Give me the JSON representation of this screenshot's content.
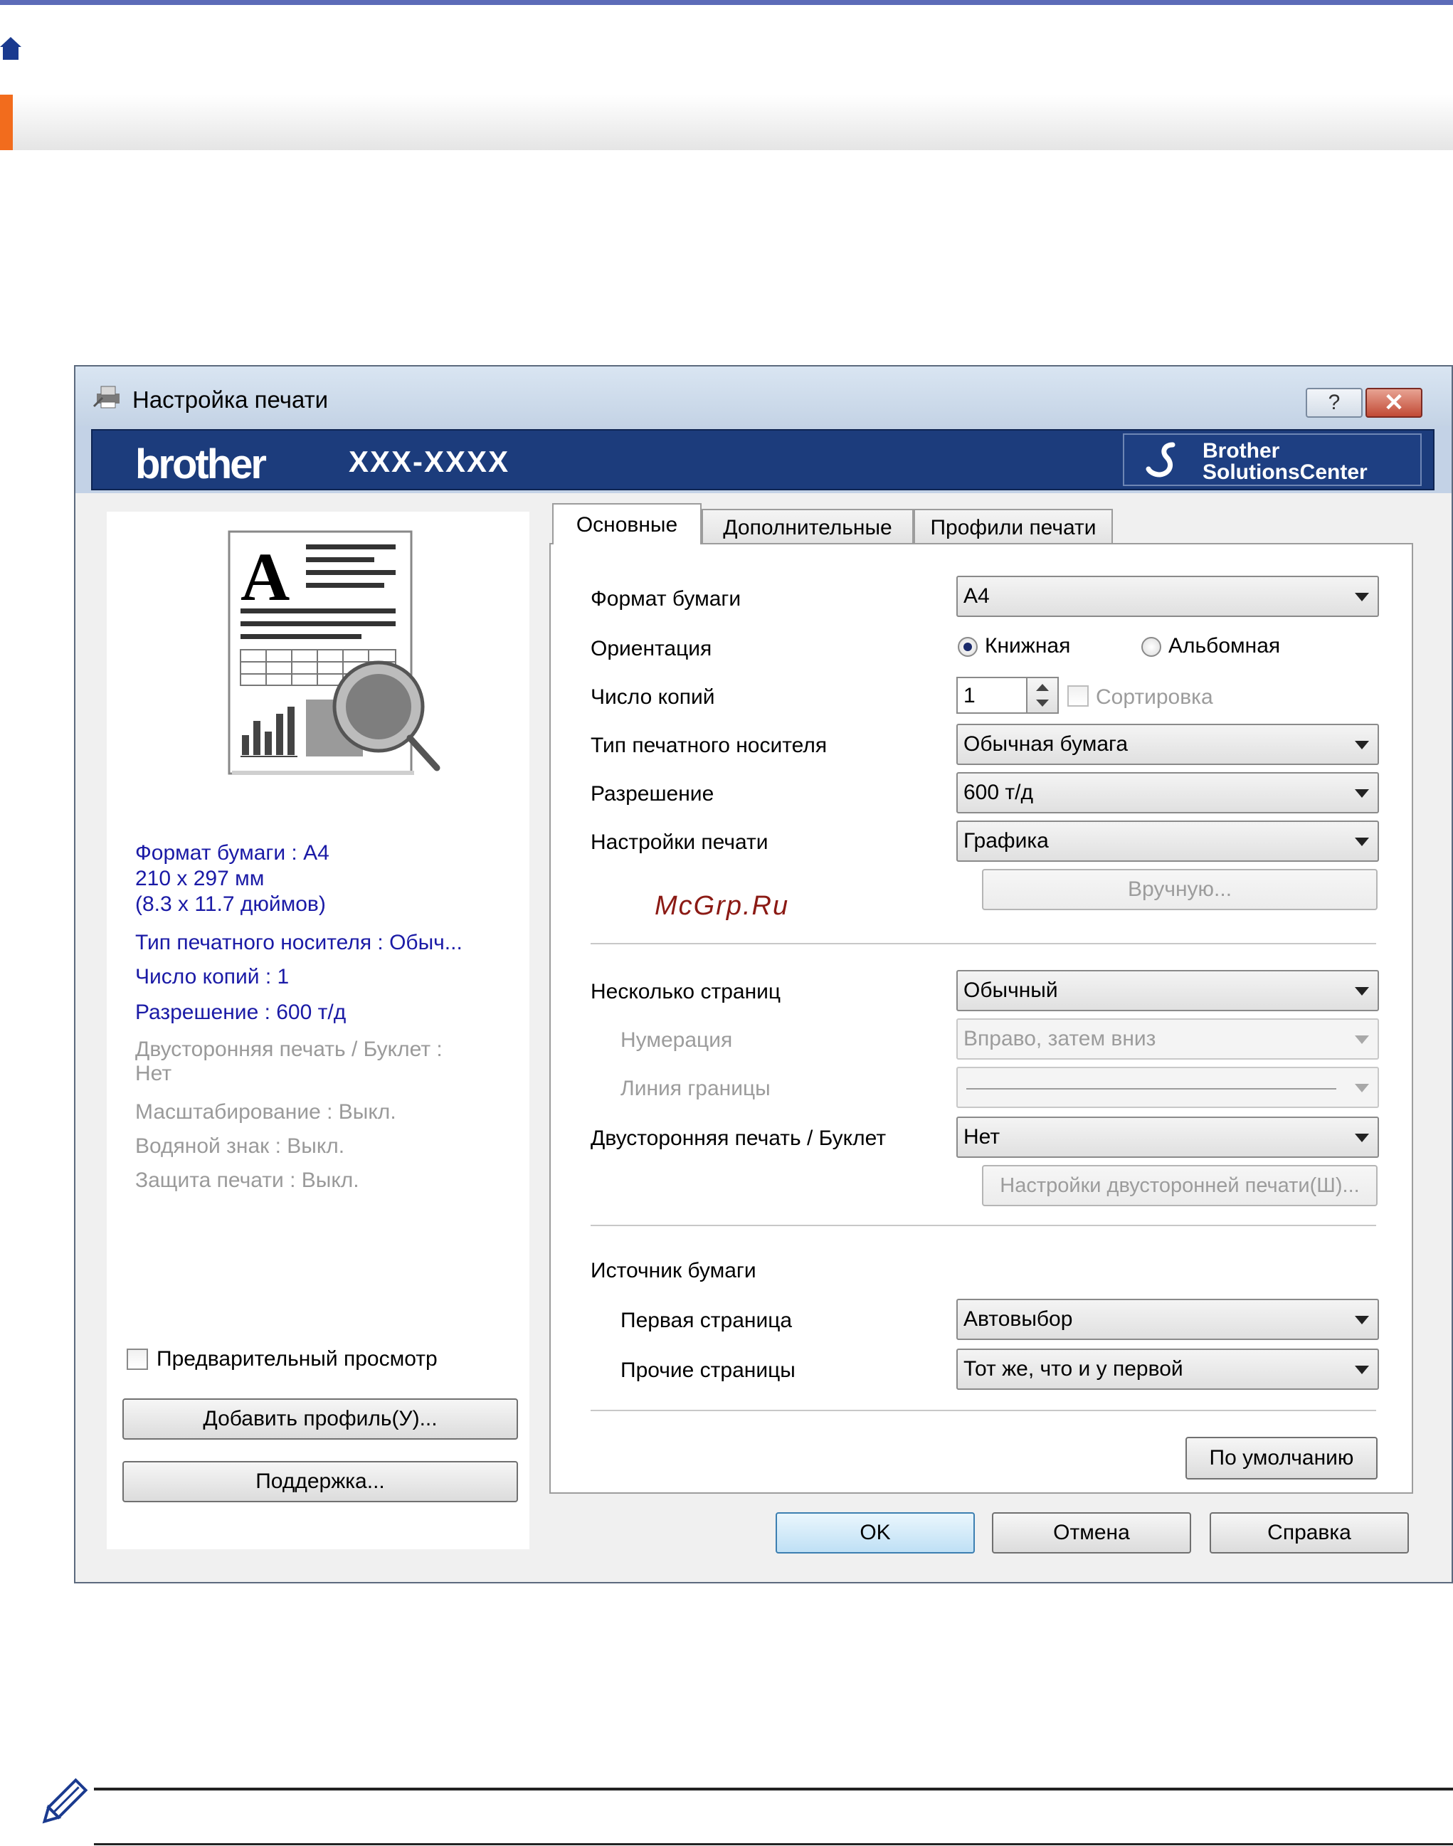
{
  "dialog": {
    "title": "Настройка печати",
    "help_glyph": "?",
    "close_glyph": "✕"
  },
  "banner": {
    "brand": "brother",
    "model": "XXX-XXXX",
    "solutions_line1": "Brother",
    "solutions_line2": "SolutionsCenter"
  },
  "summary": {
    "paper_size": "Формат бумаги : A4",
    "dimensions_mm": "210 x 297 мм",
    "dimensions_in": "(8.3 x 11.7 дюймов)",
    "media_type": "Тип печатного носителя : Обыч...",
    "copies": "Число копий : 1",
    "resolution": "Разрешение : 600 т/д",
    "duplex_1": "Двусторонняя печать / Буклет :",
    "duplex_2": "Нет",
    "scaling": "Масштабирование : Выкл.",
    "watermark": "Водяной знак : Выкл.",
    "secure": "Защита печати : Выкл."
  },
  "left": {
    "preview_label": "Предварительный просмотр",
    "add_profile": "Добавить профиль(У)...",
    "support": "Поддержка..."
  },
  "tabs": [
    "Основные",
    "Дополнительные",
    "Профили печати"
  ],
  "form": {
    "paper_size_label": "Формат бумаги",
    "paper_size_value": "A4",
    "orientation_label": "Ориентация",
    "orientation_portrait": "Книжная",
    "orientation_landscape": "Альбомная",
    "copies_label": "Число копий",
    "copies_value": "1",
    "collate_label": "Сортировка",
    "media_label": "Тип печатного носителя",
    "media_value": "Обычная бумага",
    "resolution_label": "Разрешение",
    "resolution_value": "600 т/д",
    "print_settings_label": "Настройки печати",
    "print_settings_value": "Графика",
    "manual_button": "Вручную...",
    "multi_page_label": "Несколько страниц",
    "multi_page_value": "Обычный",
    "page_order_label": "Нумерация",
    "page_order_value": "Вправо, затем вниз",
    "border_label": "Линия границы",
    "duplex_label": "Двусторонняя печать / Буклет",
    "duplex_value": "Нет",
    "duplex_settings_button": "Настройки двусторонней печати(Ш)...",
    "paper_source_label": "Источник бумаги",
    "first_page_label": "Первая страница",
    "first_page_value": "Автовыбор",
    "other_pages_label": "Прочие страницы",
    "other_pages_value": "Тот же, что и у первой",
    "default_button": "По умолчанию"
  },
  "footer": {
    "ok": "OK",
    "cancel": "Отмена",
    "help": "Справка"
  },
  "watermark_text": "McGrp.Ru",
  "colors": {
    "top_line": "#5c6bb8",
    "orange_marker": "#f26c1d",
    "banner": "#1c3c7c",
    "summary_blue": "#1a1aa6",
    "summary_gray": "#9a9a9a",
    "watermark": "#8b1a14"
  }
}
